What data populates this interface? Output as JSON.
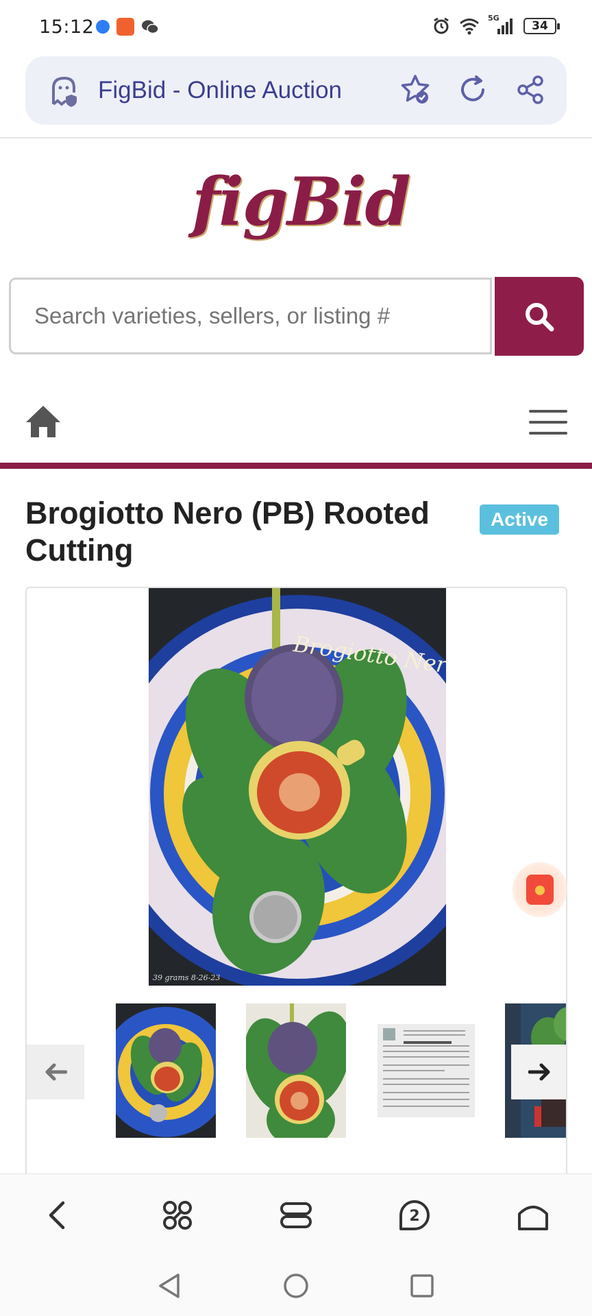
{
  "status_bar": {
    "time": "15:12",
    "battery": "34",
    "network": "5G"
  },
  "browser": {
    "page_title": "FigBid - Online Auction"
  },
  "site": {
    "logo_text": "figBid",
    "search": {
      "placeholder": "Search varieties, sellers, or listing #"
    }
  },
  "listing": {
    "title": "Brogiotto Nero (PB) Rooted Cutting",
    "status": "Active",
    "image_caption": "Brogiotto Nero",
    "image_footnote": "39 grams 8-26-23"
  },
  "colors": {
    "brand": "#8a1d47",
    "badge": "#5bc0de",
    "url_text": "#3b3f8f"
  },
  "gallery_nav": {
    "prev_icon": "arrow-left-icon",
    "next_icon": "arrow-right-icon"
  },
  "bottom_nav": {
    "tab_count": "2"
  }
}
